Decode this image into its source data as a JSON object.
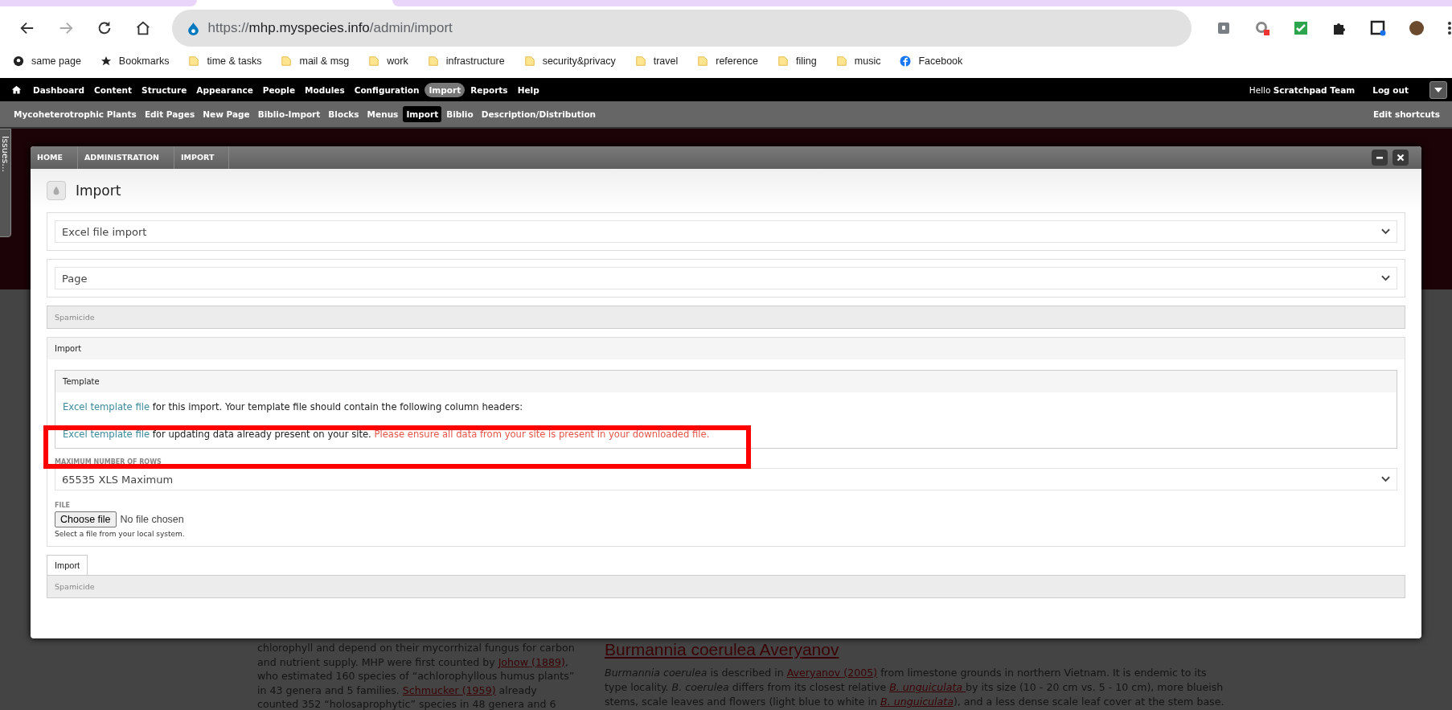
{
  "browser": {
    "url": {
      "scheme": "https://",
      "host": "mhp.myspecies.info",
      "path": "/admin/import"
    },
    "bookmarks": [
      {
        "label": "same page",
        "kind": "site"
      },
      {
        "label": "Bookmarks",
        "kind": "star"
      },
      {
        "label": "time & tasks",
        "kind": "folder"
      },
      {
        "label": "mail & msg",
        "kind": "folder"
      },
      {
        "label": "work",
        "kind": "folder"
      },
      {
        "label": "infrastructure",
        "kind": "folder"
      },
      {
        "label": "security&privacy",
        "kind": "folder"
      },
      {
        "label": "travel",
        "kind": "folder"
      },
      {
        "label": "reference",
        "kind": "folder"
      },
      {
        "label": "filing",
        "kind": "folder"
      },
      {
        "label": "music",
        "kind": "folder"
      },
      {
        "label": "Facebook",
        "kind": "facebook"
      }
    ]
  },
  "admin_menu": {
    "items": [
      {
        "label": "Dashboard",
        "selected": false
      },
      {
        "label": "Content",
        "selected": false
      },
      {
        "label": "Structure",
        "selected": false
      },
      {
        "label": "Appearance",
        "selected": false
      },
      {
        "label": "People",
        "selected": false
      },
      {
        "label": "Modules",
        "selected": false
      },
      {
        "label": "Configuration",
        "selected": false
      },
      {
        "label": "Import",
        "selected": true
      },
      {
        "label": "Reports",
        "selected": false
      },
      {
        "label": "Help",
        "selected": false
      }
    ],
    "greeting": "Hello **Scratchpad Team**",
    "logout": "Log out"
  },
  "shortcuts": {
    "items": [
      {
        "label": "Mycoheterotrophic Plants",
        "selected": false
      },
      {
        "label": "Edit Pages",
        "selected": false
      },
      {
        "label": "New Page",
        "selected": false
      },
      {
        "label": "Biblio-Import",
        "selected": false
      },
      {
        "label": "Blocks",
        "selected": false
      },
      {
        "label": "Menus",
        "selected": false
      },
      {
        "label": "Import",
        "selected": true
      },
      {
        "label": "Biblio",
        "selected": false
      },
      {
        "label": "Description/Distribution",
        "selected": false
      }
    ],
    "edit": "Edit shortcuts"
  },
  "side_tab": "Issues…",
  "modal": {
    "breadcrumb": [
      "HOME",
      "ADMINISTRATION",
      "IMPORT"
    ],
    "title": "Import",
    "selects": [
      "Excel file import",
      "Page"
    ],
    "spamicide_top": "Spamicide",
    "import_fieldset": {
      "legend": "Import",
      "template": {
        "legend": "Template",
        "line1": {
          "link": "Excel template file",
          "text": " for this import. Your template file should contain the following column headers:"
        },
        "line2": {
          "link": "Excel template file",
          "text": " for updating data already present on your site. ",
          "warning": "Please ensure all data from your site is present in your downloaded file."
        }
      },
      "max_rows": {
        "label": "MAXIMUM NUMBER OF ROWS",
        "value": "65535 XLS Maximum"
      },
      "file": {
        "label": "FILE",
        "button": "Choose file",
        "status": "No file chosen",
        "help": "Select a file from your local system."
      }
    },
    "import_button": "Import",
    "spamicide_bottom": "Spamicide"
  },
  "background": {
    "left_lines": [
      [
        {
          "text": "chlorophyll and depend on their mycorrhizal fungus for carbon",
          "kind": "plain"
        }
      ],
      [
        {
          "text": "and nutrient supply. MHP were first counted by ",
          "kind": "plain"
        },
        {
          "text": "Johow (1889)",
          "kind": "link"
        },
        {
          "text": ",",
          "kind": "plain"
        }
      ],
      [
        {
          "text": "who estimated 160 species of “achlorophyllous humus plants”",
          "kind": "plain"
        }
      ],
      [
        {
          "text": "in 43 genera and 5 families. ",
          "kind": "plain"
        },
        {
          "text": "Schmucker (1959)",
          "kind": "link"
        },
        {
          "text": " already",
          "kind": "plain"
        }
      ],
      [
        {
          "text": "counted 352 “holosaprophytic” species in 48 genera and 6",
          "kind": "plain"
        }
      ]
    ],
    "heading": "Burmannia coerulea Averyanov",
    "right_lines": [
      [
        {
          "text": "Burmannia coerulea",
          "kind": "italic"
        },
        {
          "text": " is described in ",
          "kind": "plain"
        },
        {
          "text": "Averyanov (2005)",
          "kind": "link"
        },
        {
          "text": " from limestone grounds in northern Vietnam. It is endemic to its",
          "kind": "plain"
        }
      ],
      [
        {
          "text": "type locality. ",
          "kind": "plain"
        },
        {
          "text": "B. coerulea",
          "kind": "italic"
        },
        {
          "text": " differs from its closest relative ",
          "kind": "plain"
        },
        {
          "text": "B. unguiculata ",
          "kind": "italic_link"
        },
        {
          "text": "by its size (10 - 20 cm vs. 5 - 10 cm), more blueish",
          "kind": "plain"
        }
      ],
      [
        {
          "text": "stems, scale leaves and flowers (light blue to white in ",
          "kind": "plain"
        },
        {
          "text": "B. unguiculata",
          "kind": "italic_link"
        },
        {
          "text": "), and a less dense scale leaf cover at the stem base.",
          "kind": "plain"
        }
      ]
    ]
  }
}
